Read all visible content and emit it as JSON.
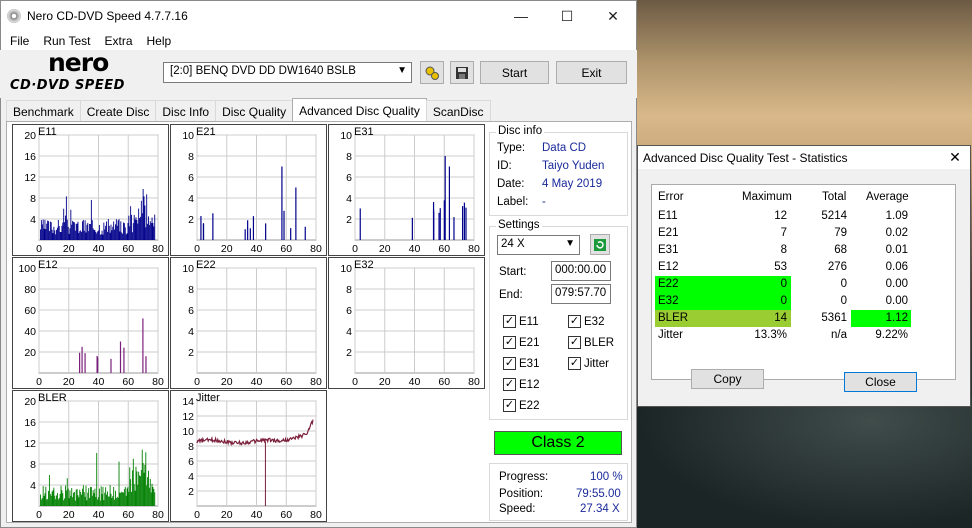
{
  "app": {
    "title": "Nero CD-DVD Speed 4.7.7.16",
    "logo_top": "nero",
    "logo_bottom": "CD·DVD SPEED"
  },
  "window_controls": {
    "minimize": "—",
    "maximize": "☐",
    "close": "✕"
  },
  "menu": [
    "File",
    "Run Test",
    "Extra",
    "Help"
  ],
  "toolbar": {
    "drive": "[2:0]  BENQ DVD DD DW1640 BSLB",
    "start": "Start",
    "exit": "Exit"
  },
  "tabs": [
    "Benchmark",
    "Create Disc",
    "Disc Info",
    "Disc Quality",
    "Advanced Disc Quality",
    "ScanDisc"
  ],
  "active_tab": "Advanced Disc Quality",
  "disc_info": {
    "title": "Disc info",
    "type_label": "Type:",
    "type": "Data CD",
    "id_label": "ID:",
    "id": "Taiyo Yuden",
    "date_label": "Date:",
    "date": "4 May 2019",
    "label_label": "Label:",
    "label": "-"
  },
  "settings": {
    "title": "Settings",
    "speed": "24 X",
    "start_label": "Start:",
    "start": "000:00.00",
    "end_label": "End:",
    "end": "079:57.70"
  },
  "checkboxes": [
    {
      "label": "E11",
      "checked": true
    },
    {
      "label": "E32",
      "checked": true
    },
    {
      "label": "E21",
      "checked": true
    },
    {
      "label": "BLER",
      "checked": true
    },
    {
      "label": "E31",
      "checked": true
    },
    {
      "label": "Jitter",
      "checked": true
    },
    {
      "label": "E12",
      "checked": true
    },
    {
      "label": "E22",
      "checked": true
    }
  ],
  "class": "Class 2",
  "progress": {
    "progress_label": "Progress:",
    "progress": "100 %",
    "position_label": "Position:",
    "position": "79:55.00",
    "speed_label": "Speed:",
    "speed": "27.34 X"
  },
  "colors": {
    "bar": "#00008b",
    "e12": "#7b1f7b",
    "bler": "#008000",
    "jitter": "#7b1f3b",
    "green": "#00ff00",
    "lime": "#9acd32"
  },
  "chart_data": [
    {
      "type": "bar",
      "title": "E11",
      "x_ticks": [
        "0",
        "20",
        "40",
        "60",
        "80"
      ],
      "y_ticks": [
        "4",
        "8",
        "12",
        "16",
        "20"
      ],
      "ylim": [
        0,
        20
      ],
      "xlim": [
        0,
        80
      ]
    },
    {
      "type": "bar",
      "title": "E21",
      "x_ticks": [
        "0",
        "20",
        "40",
        "60",
        "80"
      ],
      "y_ticks": [
        "2",
        "4",
        "6",
        "8",
        "10"
      ],
      "ylim": [
        0,
        10
      ],
      "xlim": [
        0,
        80
      ]
    },
    {
      "type": "bar",
      "title": "E31",
      "x_ticks": [
        "0",
        "20",
        "40",
        "60",
        "80"
      ],
      "y_ticks": [
        "2",
        "4",
        "6",
        "8",
        "10"
      ],
      "ylim": [
        0,
        10
      ],
      "xlim": [
        0,
        80
      ]
    },
    {
      "type": "bar",
      "title": "E12",
      "x_ticks": [
        "0",
        "20",
        "40",
        "60",
        "80"
      ],
      "y_ticks": [
        "20",
        "40",
        "60",
        "80",
        "100"
      ],
      "ylim": [
        0,
        100
      ],
      "xlim": [
        0,
        80
      ]
    },
    {
      "type": "bar",
      "title": "E22",
      "x_ticks": [
        "0",
        "20",
        "40",
        "60",
        "80"
      ],
      "y_ticks": [
        "2",
        "4",
        "6",
        "8",
        "10"
      ],
      "ylim": [
        0,
        10
      ],
      "xlim": [
        0,
        80
      ]
    },
    {
      "type": "bar",
      "title": "E32",
      "x_ticks": [
        "0",
        "20",
        "40",
        "60",
        "80"
      ],
      "y_ticks": [
        "2",
        "4",
        "6",
        "8",
        "10"
      ],
      "ylim": [
        0,
        10
      ],
      "xlim": [
        0,
        80
      ]
    },
    {
      "type": "bar",
      "title": "BLER",
      "x_ticks": [
        "0",
        "20",
        "40",
        "60",
        "80"
      ],
      "y_ticks": [
        "4",
        "8",
        "12",
        "16",
        "20"
      ],
      "ylim": [
        0,
        20
      ],
      "xlim": [
        0,
        80
      ]
    },
    {
      "type": "line",
      "title": "Jitter",
      "x_ticks": [
        "0",
        "20",
        "40",
        "60",
        "80"
      ],
      "y_ticks": [
        "2",
        "4",
        "6",
        "8",
        "10",
        "12",
        "14"
      ],
      "ylim": [
        0,
        14
      ],
      "xlim": [
        0,
        80
      ]
    }
  ],
  "stats": {
    "title": "Advanced Disc Quality Test - Statistics",
    "headers": [
      "Error",
      "Maximum",
      "Total",
      "Average"
    ],
    "rows": [
      {
        "name": "E11",
        "max": "12",
        "total": "5214",
        "avg": "1.09"
      },
      {
        "name": "E21",
        "max": "7",
        "total": "79",
        "avg": "0.02"
      },
      {
        "name": "E31",
        "max": "8",
        "total": "68",
        "avg": "0.01"
      },
      {
        "name": "E12",
        "max": "53",
        "total": "276",
        "avg": "0.06"
      },
      {
        "name": "E22",
        "max": "0",
        "total": "0",
        "avg": "0.00"
      },
      {
        "name": "E32",
        "max": "0",
        "total": "0",
        "avg": "0.00"
      },
      {
        "name": "BLER",
        "max": "14",
        "total": "5361",
        "avg": "1.12"
      },
      {
        "name": "Jitter",
        "max": "13.3%",
        "total": "n/a",
        "avg": "9.22%"
      }
    ],
    "copy": "Copy",
    "close": "Close"
  }
}
